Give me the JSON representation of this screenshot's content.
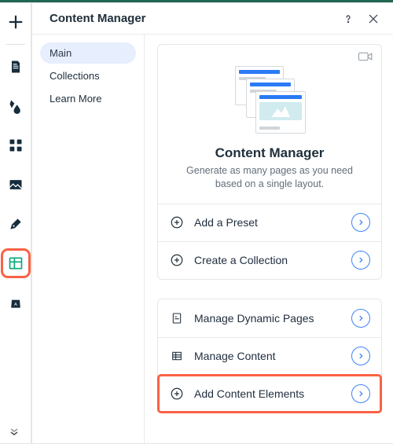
{
  "header": {
    "title": "Content Manager"
  },
  "sidenav": {
    "items": [
      {
        "label": "Main",
        "active": true
      },
      {
        "label": "Collections",
        "active": false
      },
      {
        "label": "Learn More",
        "active": false
      }
    ]
  },
  "hero": {
    "title": "Content Manager",
    "subtitle": "Generate as many pages as you need based on a single layout."
  },
  "actions_primary": [
    {
      "icon": "plus-circle",
      "label": "Add a Preset"
    },
    {
      "icon": "plus-circle",
      "label": "Create a Collection"
    }
  ],
  "actions_secondary": [
    {
      "icon": "page",
      "label": "Manage Dynamic Pages",
      "highlight": false
    },
    {
      "icon": "grid",
      "label": "Manage Content",
      "highlight": false
    },
    {
      "icon": "plus-circle",
      "label": "Add Content Elements",
      "highlight": true
    }
  ],
  "toolbar": {
    "active_index": 6
  },
  "colors": {
    "highlight": "#F96244",
    "accent": "#3D84F5"
  }
}
